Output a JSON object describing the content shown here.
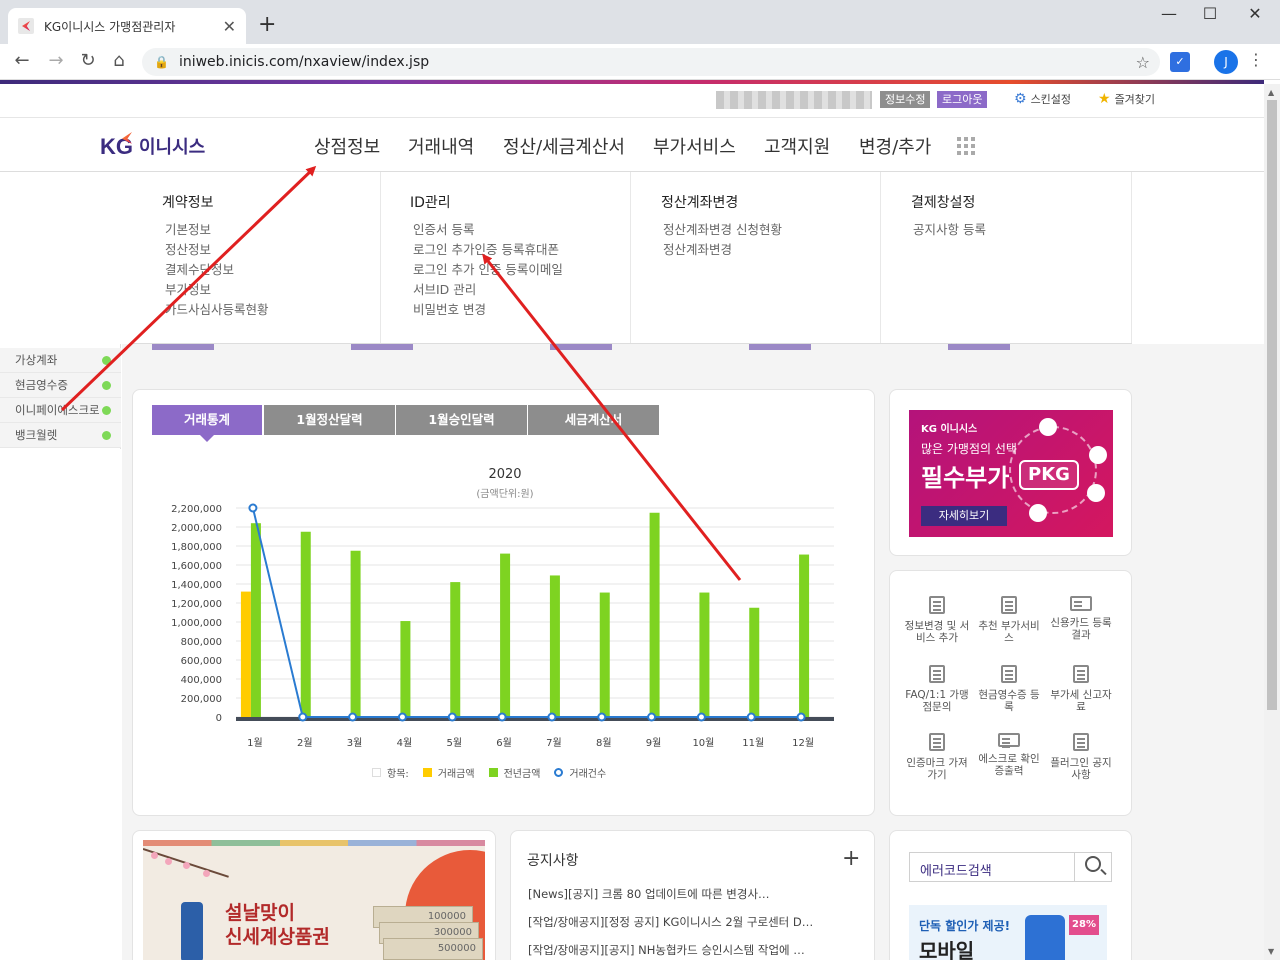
{
  "browser": {
    "tab_title": "KG이니시스 가맹점관리자",
    "tab_close": "✕",
    "new_tab": "+",
    "url": "iniweb.inicis.com/nxaview/index.jsp",
    "profile_initial": "J",
    "window_controls": [
      "—",
      "☐",
      "✕"
    ]
  },
  "header": {
    "edit_info": "정보수정",
    "logout": "로그아웃",
    "skin_settings": "스킨설정",
    "favorites": "즐겨찾기",
    "logo_kg": "KG",
    "logo_name": "이니시스"
  },
  "gnb": {
    "items": [
      "상점정보",
      "거래내역",
      "정산/세금계산서",
      "부가서비스",
      "고객지원",
      "변경/추가"
    ]
  },
  "mega_menu": [
    {
      "title": "계약정보",
      "items": [
        "기본정보",
        "정산정보",
        "결제수단정보",
        "부가정보",
        "카드사심사등록현황"
      ]
    },
    {
      "title": "ID관리",
      "items": [
        "인증서 등록",
        "로그인 추가인증 등록휴대폰",
        "로그인 추가 인증 등록이메일",
        "서브ID 관리",
        "비밀번호 변경"
      ]
    },
    {
      "title": "정산계좌변경",
      "items": [
        "정산계좌변경 신청현황",
        "정산계좌변경"
      ]
    },
    {
      "title": "결제창설정",
      "items": [
        "공지사항 등록"
      ]
    }
  ],
  "sidebar": {
    "items": [
      "가상계좌",
      "현금영수증",
      "이니페이에스크로",
      "뱅크월렛"
    ]
  },
  "chart_tabs": [
    "거래통계",
    "1월정산달력",
    "1월승인달력",
    "세금계산서"
  ],
  "chart_data": {
    "type": "bar",
    "title": "2020",
    "subtitle": "(금액단위:원)",
    "categories": [
      "1월",
      "2월",
      "3월",
      "4월",
      "5월",
      "6월",
      "7월",
      "8월",
      "9월",
      "10월",
      "11월",
      "12월"
    ],
    "series": [
      {
        "name": "거래금액",
        "kind": "bar",
        "color": "#ffcc00",
        "values": [
          1320000,
          0,
          0,
          0,
          0,
          0,
          0,
          0,
          0,
          0,
          0,
          0
        ]
      },
      {
        "name": "전년금액",
        "kind": "bar",
        "color": "#7ed321",
        "values": [
          2040000,
          1950000,
          1750000,
          1010000,
          1420000,
          1720000,
          1490000,
          1310000,
          2150000,
          1310000,
          1150000,
          1710000
        ]
      },
      {
        "name": "거래건수",
        "kind": "line",
        "color": "#2a7bd1",
        "values": [
          2200000,
          0,
          0,
          0,
          0,
          0,
          0,
          0,
          0,
          0,
          0,
          0
        ]
      }
    ],
    "ylim": [
      0,
      2200000
    ],
    "yticks": [
      "0",
      "200,000",
      "400,000",
      "600,000",
      "800,000",
      "1,000,000",
      "1,200,000",
      "1,400,000",
      "1,600,000",
      "1,800,000",
      "2,000,000",
      "2,200,000"
    ],
    "legend_label": "항목:",
    "legend_position": "bottom"
  },
  "pkg_banner": {
    "brand": "KG 이니시스",
    "line1": "많은 가맹점의 선택",
    "line2": "필수부가",
    "pkg": "PKG",
    "more": "자세히보기"
  },
  "quick_menu": [
    "정보변경 및 서비스 추가",
    "추천 부가서비스",
    "신용카드 등록결과",
    "FAQ/1:1 가맹점문의",
    "현금영수증 등록",
    "부가세 신고자료",
    "인증마크 가져가기",
    "에스크로 확인증출력",
    "플러그인 공지사항"
  ],
  "promo": {
    "line1": "설날맞이",
    "line2": "신세계상품권",
    "bills": [
      "100000",
      "300000",
      "500000"
    ]
  },
  "notice": {
    "title": "공지사항",
    "plus": "+",
    "items": [
      "[News][공지] 크롬 80 업데이트에 따른 변경사…",
      "[작업/장애공지][정정 공지] KG이니시스 2월 구로센터 D…",
      "[작업/장애공지][공지] NH농협카드 승인시스템 작업에 …"
    ]
  },
  "error_search": {
    "label": "에러코드검색"
  },
  "mobile_promo": {
    "line1": "단독 할인가 제공!",
    "line2": "모바일",
    "badge": "28%"
  }
}
